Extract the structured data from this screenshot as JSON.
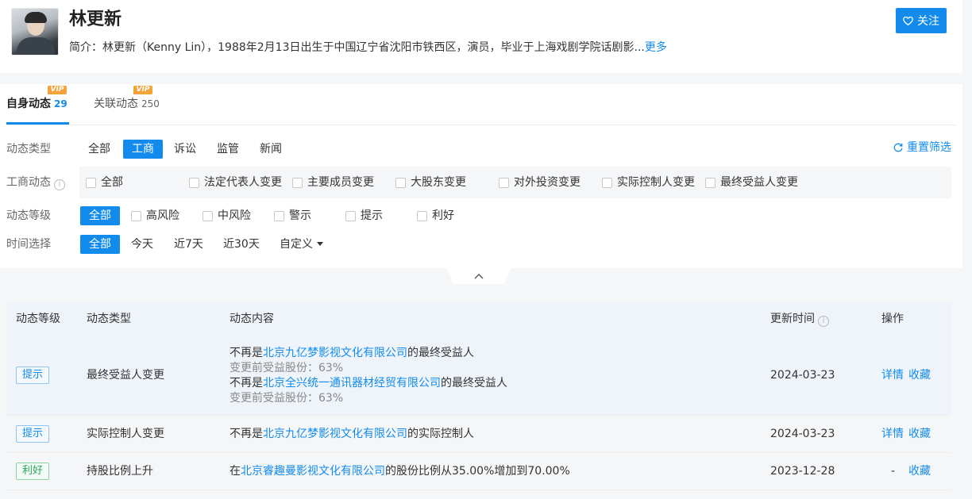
{
  "profile": {
    "name": "林更新",
    "intro_prefix": "简介：",
    "intro_text": "林更新（Kenny Lin），1988年2月13日出生于中国辽宁省沈阳市铁西区，演员，毕业于上海戏剧学院话剧影...",
    "more_label": "更多",
    "follow_label": "关注"
  },
  "tabs": [
    {
      "label": "自身动态",
      "count": "29",
      "badge": "VIP"
    },
    {
      "label": "关联动态",
      "count": "250",
      "badge": "VIP"
    }
  ],
  "filters": {
    "reset_label": "重置筛选",
    "type": {
      "label": "动态类型",
      "options": [
        "全部",
        "工商",
        "诉讼",
        "监管",
        "新闻"
      ],
      "selected": "工商"
    },
    "business": {
      "label": "工商动态",
      "info_icon": "i",
      "options": [
        "全部",
        "法定代表人变更",
        "主要成员变更",
        "大股东变更",
        "对外投资变更",
        "实际控制人变更",
        "最终受益人变更"
      ]
    },
    "level": {
      "label": "动态等级",
      "selected": "全部",
      "options": [
        "高风险",
        "中风险",
        "警示",
        "提示",
        "利好"
      ]
    },
    "time": {
      "label": "时间选择",
      "selected": "全部",
      "options": [
        "今天",
        "近7天",
        "近30天",
        "自定义"
      ]
    }
  },
  "table": {
    "headers": [
      "动态等级",
      "动态类型",
      "动态内容",
      "更新时间",
      "操作"
    ],
    "rows": [
      {
        "level": "提示",
        "type": "最终受益人变更",
        "lines": [
          {
            "pre": "不再是",
            "company": "北京九亿梦影视文化有限公司",
            "post": "的最终受益人"
          },
          {
            "sub": "变更前受益股份：63%"
          },
          {
            "pre": "不再是",
            "company": "北京全兴统一通讯器材经贸有限公司",
            "post": "的最终受益人"
          },
          {
            "sub": "变更前受益股份：63%"
          }
        ],
        "date": "2024-03-23",
        "detail": "详情",
        "collect": "收藏"
      },
      {
        "level": "提示",
        "type": "实际控制人变更",
        "pre": "不再是",
        "company": "北京九亿梦影视文化有限公司",
        "post": "的实际控制人",
        "date": "2024-03-23",
        "detail": "详情",
        "collect": "收藏"
      },
      {
        "level": "利好",
        "type": "持股比例上升",
        "pre": "在",
        "company": "北京睿趣曼影视文化有限公司",
        "post": "的股份比例从35.00%增加到70.00%",
        "date": "2023-12-28",
        "detail": "-",
        "collect": "收藏"
      }
    ]
  },
  "colors": {
    "accent": "#128bed",
    "good": "#2aa55a",
    "vip": "#f3a33a"
  }
}
